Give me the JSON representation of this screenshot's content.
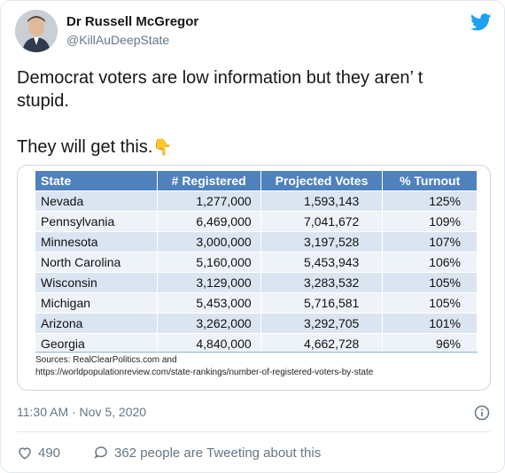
{
  "header": {
    "name": "Dr Russell McGregor",
    "handle": "@KillAuDeepState",
    "twitter_logo_icon": "twitter-bird-icon",
    "brand_color": "#1da1f2"
  },
  "tweet": {
    "line1": "Democrat voters are low information but they aren’ t",
    "line2": "stupid.",
    "line3": "They will get this.",
    "emoji_icon": "pointing-down-hand-icon"
  },
  "table": {
    "headers": [
      "State",
      "# Registered",
      "Projected Votes",
      "% Turnout"
    ],
    "rows": [
      [
        "Nevada",
        "1,277,000",
        "1,593,143",
        "125%"
      ],
      [
        "Pennsylvania",
        "6,469,000",
        "7,041,672",
        "109%"
      ],
      [
        "Minnesota",
        "3,000,000",
        "3,197,528",
        "107%"
      ],
      [
        "North Carolina",
        "5,160,000",
        "5,453,943",
        "106%"
      ],
      [
        "Wisconsin",
        "3,129,000",
        "3,283,532",
        "105%"
      ],
      [
        "Michigan",
        "5,453,000",
        "5,716,581",
        "105%"
      ],
      [
        "Arizona",
        "3,262,000",
        "3,292,705",
        "101%"
      ],
      [
        "Georgia",
        "4,840,000",
        "4,662,728",
        "96%"
      ]
    ],
    "sources_line1": "Sources: RealClearPolitics.com and",
    "sources_line2": "https://worldpopulationreview.com/state-rankings/number-of-registered-voters-by-state",
    "header_color": "#4f81bd"
  },
  "footer": {
    "timestamp": "11:30 AM · Nov 5, 2020",
    "like_count": "490",
    "reply_text": "362 people are Tweeting about this",
    "info_icon": "info-icon",
    "like_icon": "heart-icon",
    "reply_icon": "speech-bubble-icon"
  }
}
